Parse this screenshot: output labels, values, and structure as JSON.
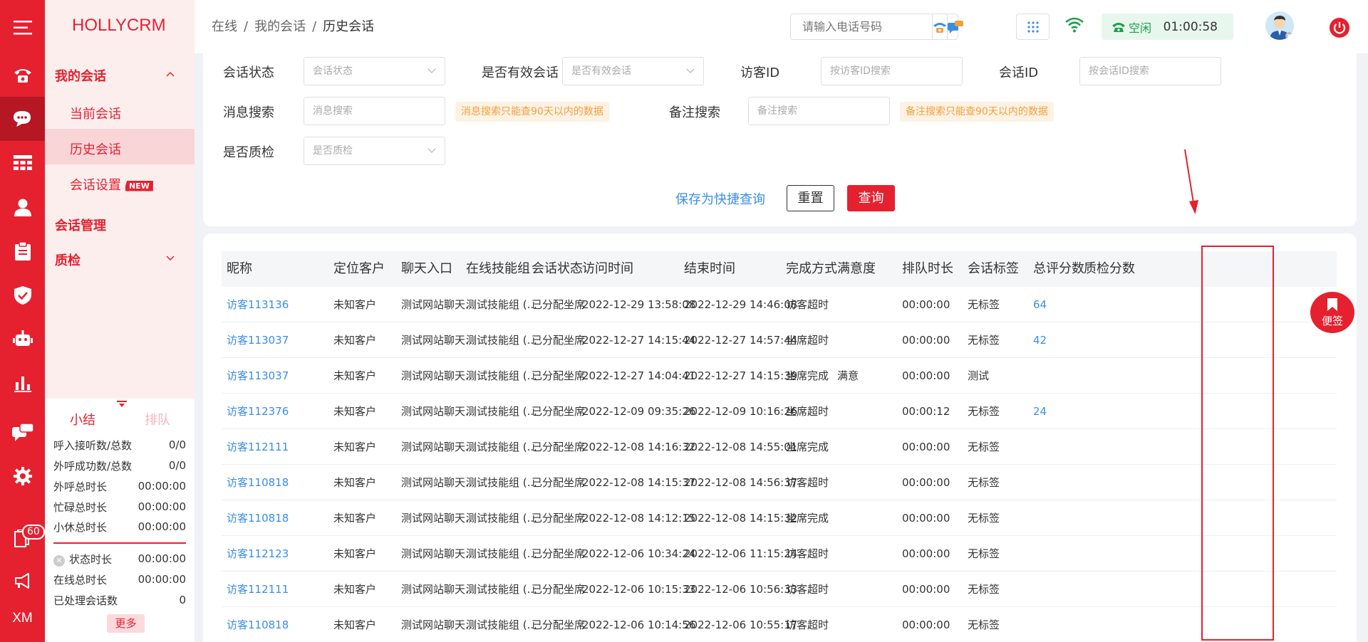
{
  "brand": {
    "logo": "HOLLYCRM",
    "accent": "#e5212f",
    "link": "#3a8ee6"
  },
  "icon_bar": {
    "items": [
      "menu-icon",
      "phone-icon",
      "chat-icon",
      "table-icon",
      "user-icon",
      "clipboard-icon",
      "shield-icon",
      "robot-icon",
      "bar-chart-icon",
      "message-icon",
      "gear-icon",
      "book-icon",
      "megaphone-icon"
    ],
    "badge": "60",
    "footer": "XM"
  },
  "nav": {
    "group1": "我的会话",
    "items": [
      "当前会话",
      "历史会话",
      "会话设置"
    ],
    "new_badge": "NEW",
    "group2": "会话管理",
    "group3": "质检"
  },
  "summary": {
    "tab1": "小结",
    "tab2": "排队",
    "stats": [
      {
        "label": "呼入接听数/总数",
        "value": "0/0"
      },
      {
        "label": "外呼成功数/总数",
        "value": "0/0"
      },
      {
        "label": "外呼总时长",
        "value": "00:00:00"
      },
      {
        "label": "忙碌总时长",
        "value": "00:00:00"
      },
      {
        "label": "小休总时长",
        "value": "00:00:00"
      },
      {
        "label": "状态时长",
        "value": "00:00:00"
      },
      {
        "label": "在线总时长",
        "value": "00:00:00"
      },
      {
        "label": "已处理会话数",
        "value": "0"
      }
    ],
    "more": "更多"
  },
  "header": {
    "breadcrumb": [
      "在线",
      "我的会话",
      "历史会话"
    ],
    "phone_placeholder": "请输入电话号码",
    "status": "空闲",
    "timer": "01:00:58"
  },
  "filters": {
    "session_status": {
      "label": "会话状态",
      "placeholder": "会话状态"
    },
    "valid_session": {
      "label": "是否有效会话",
      "placeholder": "是否有效会话"
    },
    "visitor_id": {
      "label": "访客ID",
      "placeholder": "按访客ID搜索"
    },
    "session_id": {
      "label": "会话ID",
      "placeholder": "按会话ID搜索"
    },
    "message_search": {
      "label": "消息搜索",
      "placeholder": "消息搜索",
      "hint": "消息搜索只能查90天以内的数据"
    },
    "remark_search": {
      "label": "备注搜索",
      "placeholder": "备注搜索",
      "hint": "备注搜索只能查90天以内的数据"
    },
    "quality_checked": {
      "label": "是否质检",
      "placeholder": "是否质检"
    },
    "save_quick": "保存为快捷查询",
    "reset": "重置",
    "query": "查询"
  },
  "table": {
    "columns": [
      "昵称",
      "定位客户",
      "聊天入口",
      "在线技能组",
      "会话状态",
      "访问时间",
      "结束时间",
      "完成方式",
      "满意度",
      "排队时长",
      "会话标签",
      "总评分数",
      "质检分数"
    ],
    "rows": [
      [
        "访客113136",
        "未知客户",
        "测试网站聊天...",
        "测试技能组 (...",
        "已分配坐席",
        "2022-12-29 13:58:08",
        "2022-12-29 14:46:08",
        "访客超时",
        "",
        "00:00:00",
        "无标签",
        "64",
        ""
      ],
      [
        "访客113037",
        "未知客户",
        "测试网站聊天...",
        "测试技能组 (...",
        "已分配坐席",
        "2022-12-27 14:15:44",
        "2022-12-27 14:57:44",
        "坐席超时",
        "",
        "00:00:00",
        "无标签",
        "42",
        ""
      ],
      [
        "访客113037",
        "未知客户",
        "测试网站聊天...",
        "测试技能组 (...",
        "已分配坐席",
        "2022-12-27 14:04:41",
        "2022-12-27 14:15:39",
        "坐席完成",
        "满意",
        "00:00:00",
        "测试",
        "",
        ""
      ],
      [
        "访客112376",
        "未知客户",
        "测试网站聊天...",
        "测试技能组 (...",
        "已分配坐席",
        "2022-12-09 09:35:26",
        "2022-12-09 10:16:26",
        "坐席超时",
        "",
        "00:00:12",
        "无标签",
        "24",
        ""
      ],
      [
        "访客112111",
        "未知客户",
        "测试网站聊天...",
        "测试技能组 (...",
        "已分配坐席",
        "2022-12-08 14:16:32",
        "2022-12-08 14:55:01",
        "坐席完成",
        "",
        "00:00:00",
        "无标签",
        "",
        ""
      ],
      [
        "访客110818",
        "未知客户",
        "测试网站聊天...",
        "测试技能组 (...",
        "已分配坐席",
        "2022-12-08 14:15:37",
        "2022-12-08 14:56:37",
        "访客超时",
        "",
        "00:00:00",
        "无标签",
        "",
        ""
      ],
      [
        "访客110818",
        "未知客户",
        "测试网站聊天...",
        "测试技能组 (...",
        "已分配坐席",
        "2022-12-08 14:12:15",
        "2022-12-08 14:15:32",
        "坐席完成",
        "",
        "00:00:00",
        "无标签",
        "",
        ""
      ],
      [
        "访客112123",
        "未知客户",
        "测试网站聊天...",
        "测试技能组 (...",
        "已分配坐席",
        "2022-12-06 10:34:24",
        "2022-12-06 11:15:24",
        "访客超时",
        "",
        "00:00:00",
        "无标签",
        "",
        ""
      ],
      [
        "访客112111",
        "未知客户",
        "测试网站聊天...",
        "测试技能组 (...",
        "已分配坐席",
        "2022-12-06 10:15:33",
        "2022-12-06 10:56:33",
        "访客超时",
        "",
        "00:00:00",
        "无标签",
        "",
        ""
      ],
      [
        "访客110818",
        "未知客户",
        "测试网站聊天...",
        "测试技能组 (...",
        "已分配坐席",
        "2022-12-06 10:14:56",
        "2022-12-06 10:55:17",
        "访客超时",
        "",
        "00:00:00",
        "无标签",
        "",
        ""
      ]
    ]
  },
  "sticky_note": "便签"
}
